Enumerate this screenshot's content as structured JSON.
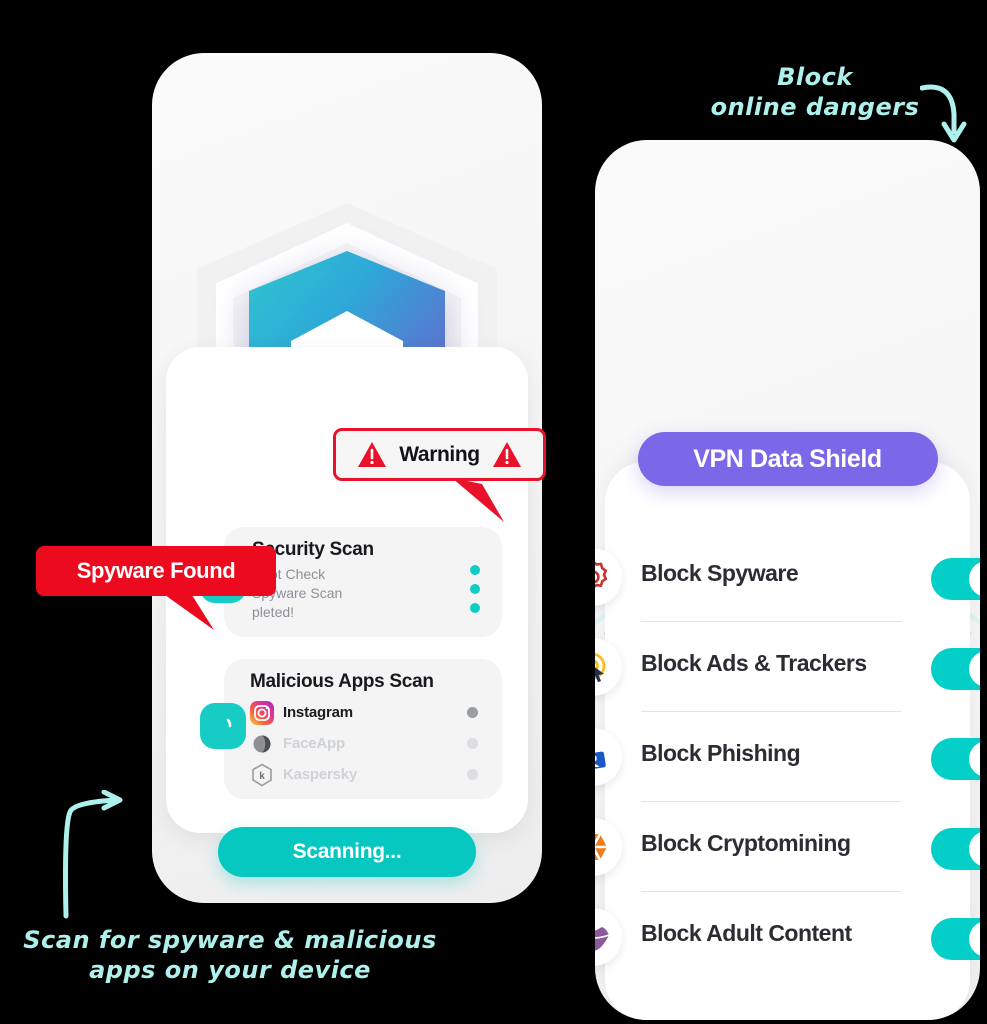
{
  "colors": {
    "teal": "#03cfc8",
    "teal_button": "#06c8c0",
    "purple": "#7b68e8",
    "red": "#ec0a1e",
    "warning_border": "#e8132a",
    "hand_teal": "#aef0ec",
    "phone_body": "#f5f5f6"
  },
  "left_phone": {
    "logo_icon": "shield-m-logo",
    "security_card": {
      "title": "Security Scan",
      "badge_icon": "phone-hash-icon",
      "lines": [
        "Root Check",
        "Spyware Scan",
        "pleted!"
      ],
      "status_dots": 3
    },
    "malicious_card": {
      "title": "Malicious Apps Scan",
      "badge_icon": "spinner-icon",
      "apps": [
        {
          "name": "Instagram",
          "icon": "instagram-icon",
          "faded": false
        },
        {
          "name": "FaceApp",
          "icon": "faceapp-icon",
          "faded": true
        },
        {
          "name": "Kaspersky",
          "icon": "kaspersky-icon",
          "faded": true
        }
      ]
    },
    "primary_button": "Scanning..."
  },
  "callouts": {
    "warning": {
      "label": "Warning",
      "left_icon": "warning-triangle-icon",
      "right_icon": "warning-triangle-icon"
    },
    "spyware_found": {
      "label": "Spyware Found"
    }
  },
  "right_phone": {
    "badge": "VPN Data Shield",
    "features": [
      {
        "label": "Block Spyware",
        "icon": "spyware-burst-icon",
        "icon_color": "#c8322f",
        "enabled": true
      },
      {
        "label": "Block Ads & Trackers",
        "icon": "ad-cursor-icon",
        "icon_color": "#f7bf1e",
        "enabled": true
      },
      {
        "label": "Block Phishing",
        "icon": "phishing-id-card-icon",
        "icon_color": "#1757c8",
        "enabled": true
      },
      {
        "label": "Block Cryptomining",
        "icon": "crypto-hexagon-icon",
        "icon_color": "#f07c1c",
        "enabled": true
      },
      {
        "label": "Block Adult Content",
        "icon": "lips-icon",
        "icon_color": "#8a5a9b",
        "enabled": true
      }
    ]
  },
  "annotations": {
    "top": {
      "line1": "Block",
      "line2": "online dangers",
      "arrow": "curved-arrow-down-icon"
    },
    "bottom": {
      "line1": "Scan for spyware & malicious",
      "line2": "apps on your device",
      "arrow": "curved-arrow-up-right-icon"
    }
  }
}
